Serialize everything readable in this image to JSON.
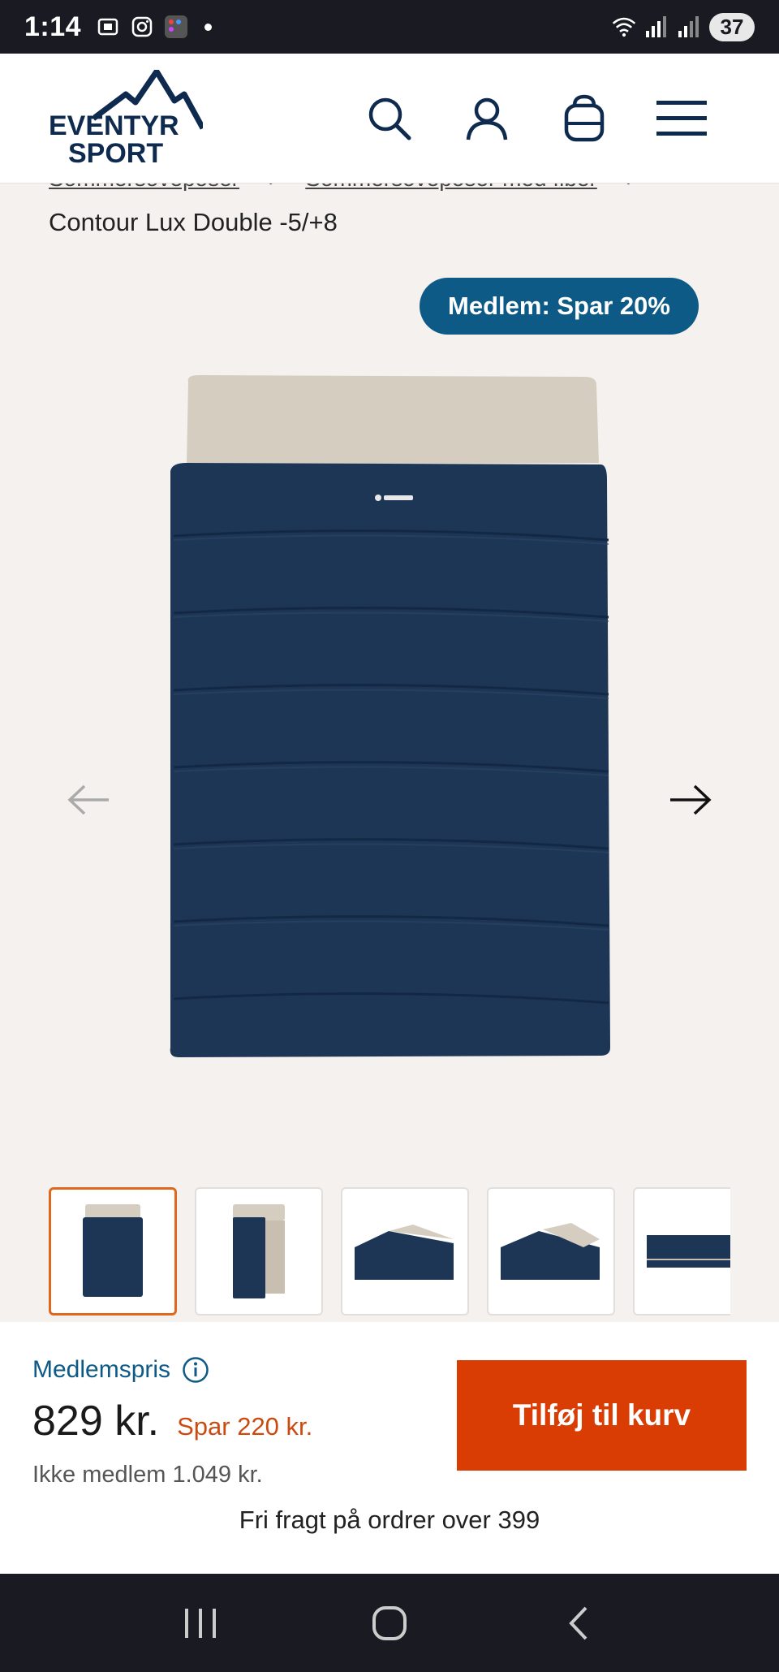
{
  "status_bar": {
    "time": "1:14",
    "battery": "37"
  },
  "header": {
    "logo_line1": "EVENTYR",
    "logo_line2": "SPORT",
    "icons": [
      "search-icon",
      "account-icon",
      "bag-icon",
      "menu-icon"
    ]
  },
  "breadcrumb": {
    "items": [
      "Sommersoveposer",
      "Sommersoveposer med fiber"
    ]
  },
  "product": {
    "title": "Contour Lux Double -5/+8",
    "member_badge": "Medlem: Spar 20%",
    "thumbnail_count": 5
  },
  "purchase": {
    "member_price_label": "Medlemspris",
    "price": "829 kr.",
    "savings": "Spar 220 kr.",
    "non_member": "Ikke medlem 1.049 kr.",
    "add_to_cart": "Tilføj til kurv",
    "free_shipping": "Fri fragt på ordrer over 399"
  },
  "colors": {
    "brand_navy": "#0f2a4f",
    "member_blue": "#0e5a86",
    "cta_orange": "#d93d04",
    "thumb_active": "#e0681d"
  }
}
